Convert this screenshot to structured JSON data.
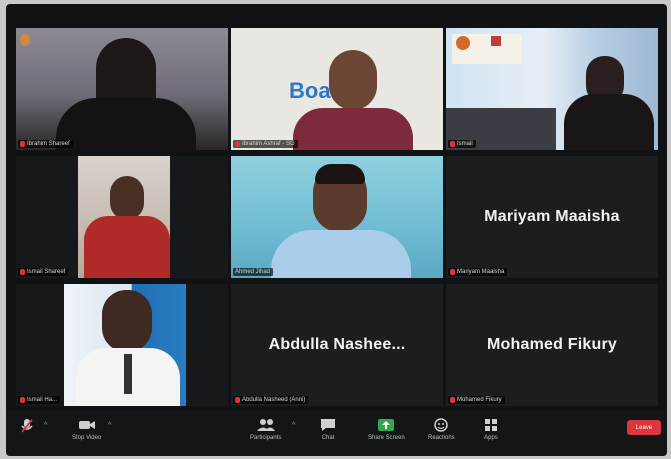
{
  "participants": [
    {
      "name": "Ibrahim Shareef",
      "big": ""
    },
    {
      "name": "Ibrahim Ashraf - SG",
      "big": ""
    },
    {
      "name": "Ismail",
      "big": ""
    },
    {
      "name": "Ismail Shareef",
      "big": ""
    },
    {
      "name": "Ahmed Jihad",
      "big": ""
    },
    {
      "name": "Mariyam Maaisha",
      "big": "Mariyam Maaisha"
    },
    {
      "name": "Ismail Ha...",
      "big": ""
    },
    {
      "name": "Abdulla Nasheed (Anni)",
      "big": "Abdulla Nashee..."
    },
    {
      "name": "Mohamed Fikury",
      "big": "Mohamed Fikury"
    }
  ],
  "backdrop_text": "Boa...g",
  "toolbar": {
    "unmute": "",
    "video": "Stop Video",
    "participants": "Participants",
    "chat": "Chat",
    "share": "Share Screen",
    "reactions": "Reactions",
    "apps": "Apps",
    "leave": "Leave"
  },
  "colors": {
    "active_border": "#d8e04a",
    "leave": "#d9363e",
    "share": "#2fa84f"
  }
}
